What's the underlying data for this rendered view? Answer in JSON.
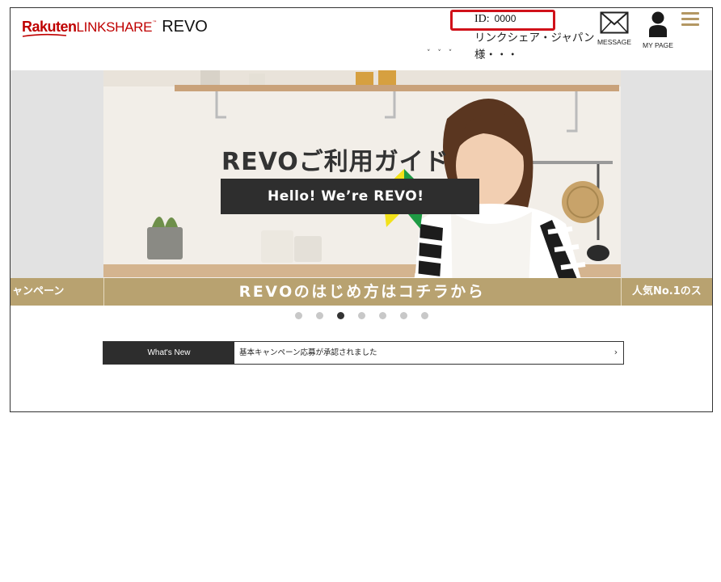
{
  "header": {
    "logo": {
      "rakuten": "Rakuten",
      "linkshare": "LINKSHARE",
      "tm": "™",
      "revo": "REVO"
    },
    "user": {
      "id_label": "ID:",
      "id_value": "0000",
      "company_line1": "リンクシェア・ジャパン",
      "company_line2": "様・・・"
    },
    "chevrons": "˅ ˅ ˅",
    "message_label": "MESSAGE",
    "mypage_label": "MY PAGE"
  },
  "carousel": {
    "slide_title": "REVOご利用ガイド",
    "slide_subtitle": "Hello! We’re REVO!",
    "band_center": "REVOのはじめ方はコチラから",
    "band_left": "ャンペーン",
    "band_right": "人気No.1のス",
    "dots_total": 7,
    "active_dot": 3
  },
  "whats_new": {
    "label": "What's New",
    "text": "基本キャンペーン応募が承認されました",
    "arrow": "›"
  },
  "colors": {
    "brand_red": "#bf0000",
    "band_gold": "#b8a270",
    "highlight_red": "#d0111a",
    "menu_gold": "#b39763"
  }
}
